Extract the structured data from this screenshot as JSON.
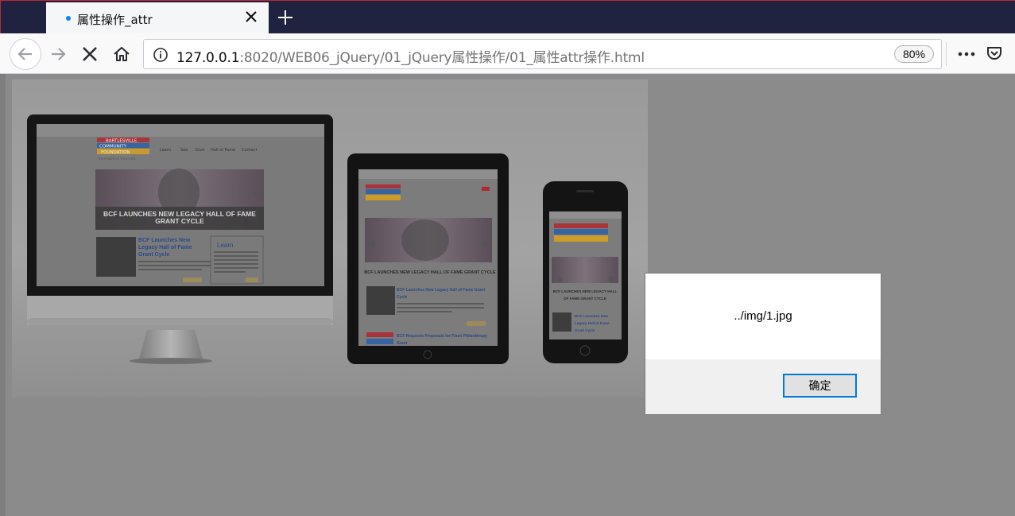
{
  "tab": {
    "title": "属性操作_attr"
  },
  "address": {
    "host": "127.0.0.1",
    "rest": ":8020/WEB06_jQuery/01_jQuery属性操作/01_属性attr操作.html",
    "zoom": "80%"
  },
  "page": {
    "image_alt": "../img/1.jpg",
    "screen_headline": "BCF LAUNCHES NEW LEGACY HALL OF FAME GRANT CYCLE",
    "tablet_headline": "BCF LAUNCHES NEW LEGACY HALL OF FAME GRANT CYCLE",
    "phone_headline": "BCF LAUNCHES NEW LEGACY HALL OF FAME GRANT CYCLE",
    "logo_line1": "BARTLESVILLE",
    "logo_line2": "COMMUNITY",
    "logo_line3": "FOUNDATION",
    "tagline": "THE POWER OF TOGETHER",
    "nav_items": [
      "Learn",
      "See",
      "Give",
      "Hall of Fame",
      "Contact"
    ],
    "article_title": "BCF Launches New Legacy Hall of Fame Grant Cycle",
    "learn_heading": "Learn"
  },
  "dialog": {
    "message": "../img/1.jpg",
    "ok_label": "确定"
  },
  "colors": {
    "tabbar": "#202340",
    "accent": "#0a84ff",
    "dialog_border": "#0078d7",
    "logo_red": "#b3262e",
    "logo_blue": "#2a5fa8",
    "logo_gold": "#d9a21b"
  },
  "icons": {
    "tab_dot": "loading-dot-icon",
    "close": "close-icon",
    "new_tab": "plus-icon",
    "back": "back-arrow-icon",
    "forward": "forward-arrow-icon",
    "stop": "stop-icon",
    "home": "home-icon",
    "info": "info-icon",
    "more": "more-icon",
    "pocket": "pocket-icon"
  }
}
